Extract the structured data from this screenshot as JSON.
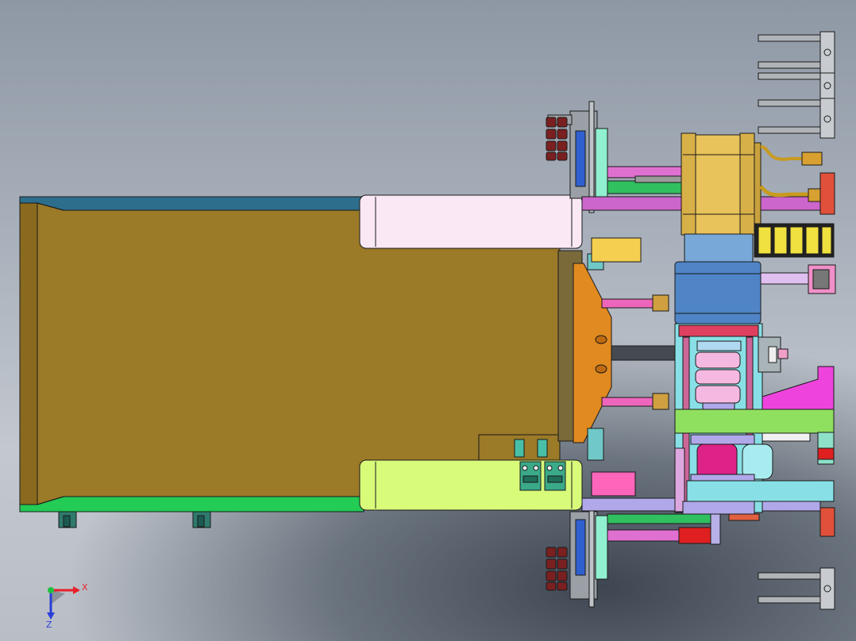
{
  "view": {
    "background_top": "#8e98a4",
    "background_bottom": "#c3c8cf"
  },
  "colors": {
    "hopper_body": "#9b7a28",
    "hopper_top_rail": "#2d6e8c",
    "hopper_bottom_rail": "#22cc55",
    "pink_block": "#fbe8f5",
    "lime_block": "#d8fb7a",
    "orange_plate": "#e08a20",
    "motor_gold": "#e8c25a",
    "coupler_blue": "#4f84c6",
    "magenta_frame": "#cc3366",
    "cyan_frame": "#88e0e6",
    "light_green": "#90e060",
    "violet_rail": "#b0a8e8",
    "red_tab": "#e0503a"
  },
  "triad": {
    "x_label": "X",
    "z_label": "Z",
    "x_color": "#e8202a",
    "y_color": "#22c040",
    "z_color": "#2a3fd8"
  }
}
